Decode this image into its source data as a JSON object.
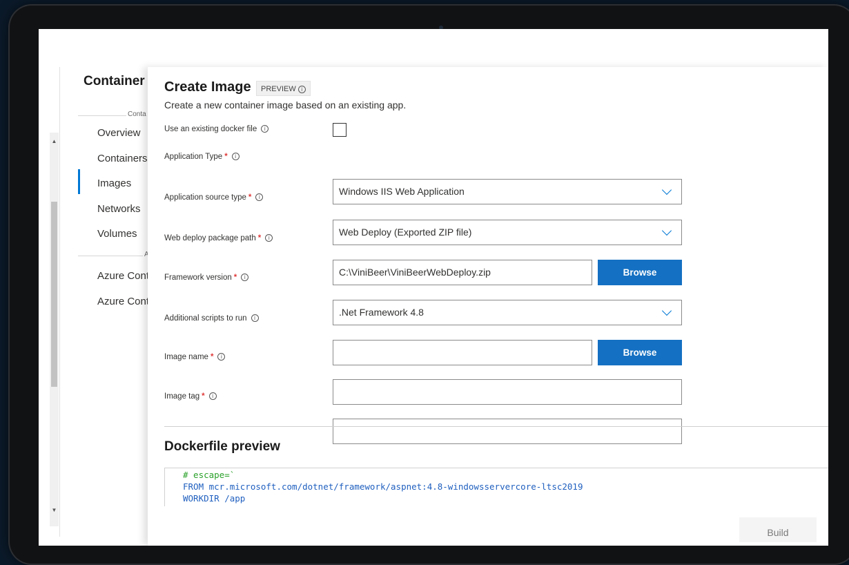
{
  "nav": {
    "title": "Container",
    "section1_label": "Conta",
    "section2_label": "A",
    "items": [
      {
        "label": "Overview"
      },
      {
        "label": "Containers"
      },
      {
        "label": "Images"
      },
      {
        "label": "Networks"
      },
      {
        "label": "Volumes"
      },
      {
        "label": "Azure Cont"
      },
      {
        "label": "Azure Cont"
      }
    ],
    "active_item": "Images"
  },
  "panel": {
    "title": "Create Image",
    "badge": "PREVIEW",
    "subtitle": "Create a new container image based on an existing app.",
    "fields": {
      "existing_docker_file": {
        "label": "Use an existing docker file",
        "checked": false
      },
      "application_type": {
        "label": "Application Type",
        "value": "Windows IIS Web Application"
      },
      "source_type": {
        "label": "Application source type",
        "value": "Web Deploy (Exported ZIP file)"
      },
      "package_path": {
        "label": "Web deploy package path",
        "value": "C:\\ViniBeer\\ViniBeerWebDeploy.zip",
        "button": "Browse"
      },
      "framework_version": {
        "label": "Framework version",
        "value": ".Net Framework 4.8"
      },
      "additional_scripts": {
        "label": "Additional scripts to run",
        "value": "",
        "button": "Browse"
      },
      "image_name": {
        "label": "Image name",
        "value": ""
      },
      "image_tag": {
        "label": "Image tag",
        "value": ""
      }
    },
    "required_marker": "*",
    "info_glyph": "i",
    "dockerfile": {
      "title": "Dockerfile preview",
      "lines": [
        "# escape=`",
        "FROM mcr.microsoft.com/dotnet/framework/aspnet:4.8-windowsservercore-ltsc2019",
        "WORKDIR /app"
      ]
    },
    "build_button": "Build"
  },
  "colors": {
    "accent": "#0078d4",
    "button": "#1470c2",
    "required": "#e03a3a",
    "code_comment": "#2aa12a",
    "code_keyword": "#1f5fbf"
  },
  "icons": {
    "info": "info-icon",
    "dropdown": "chevron-down-icon",
    "scroll_up": "scroll-up-arrow-icon",
    "scroll_down": "scroll-down-arrow-icon"
  }
}
